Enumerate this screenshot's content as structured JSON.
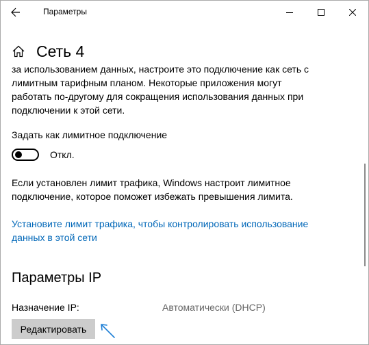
{
  "window": {
    "title": "Параметры",
    "back_icon": "back-arrow-icon",
    "minimize_icon": "minimize-icon",
    "maximize_icon": "maximize-icon",
    "close_icon": "close-icon"
  },
  "header": {
    "home_icon": "home-icon",
    "title": "Сеть 4"
  },
  "metered": {
    "description_lines": [
      "за использованием данных, настроите это подключение как сеть с",
      "лимитным тарифным планом. Некоторые приложения могут",
      "работать по-другому для сокращения использования данных при",
      "подключении к этой сети."
    ],
    "toggle_label": "Задать как лимитное подключение",
    "toggle_state": "Откл.",
    "toggle_on": false,
    "limit_info_lines": [
      "Если установлен лимит трафика, Windows настроит лимитное",
      "подключение, которое поможет избежать превышения лимита."
    ],
    "link_lines": [
      "Установите лимит трафика, чтобы контролировать использование",
      "данных в этой сети"
    ]
  },
  "ip": {
    "section_title": "Параметры IP",
    "assignment_label": "Назначение IP:",
    "assignment_value": "Автоматически (DHCP)",
    "edit_button": "Редактировать"
  },
  "colors": {
    "link": "#0067b8",
    "annotation_arrow": "#1e7fd6",
    "button_bg": "#cccccc"
  }
}
